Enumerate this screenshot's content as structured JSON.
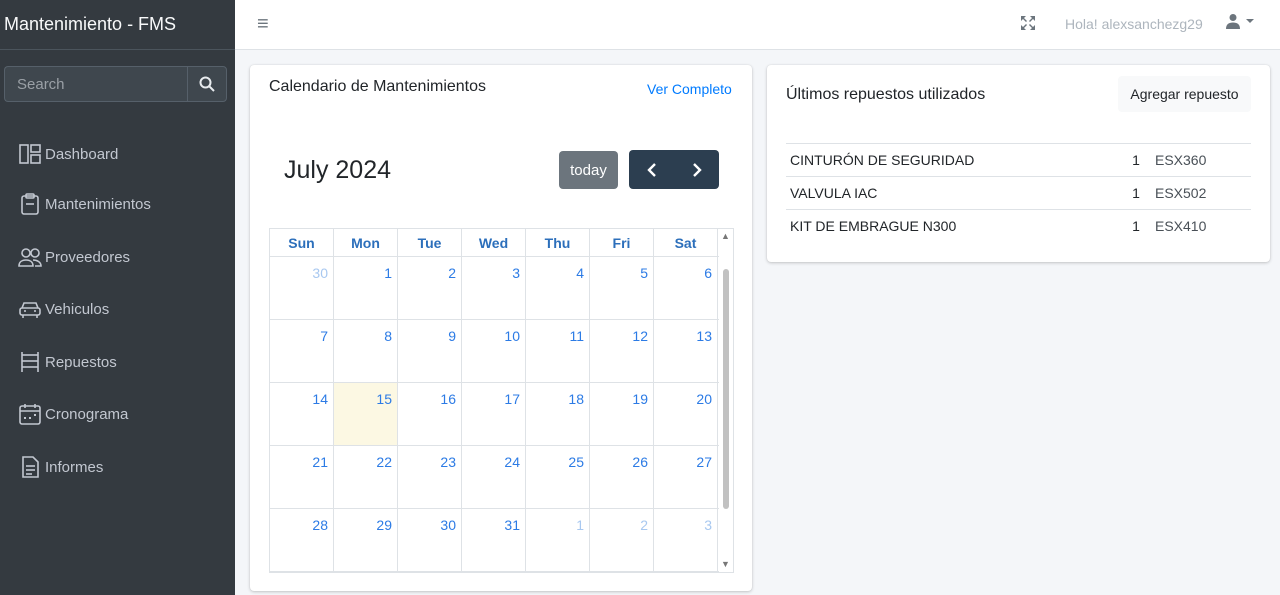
{
  "sidebar": {
    "brand": "Mantenimiento - FMS",
    "search_placeholder": "Search",
    "items": [
      {
        "label": "Dashboard",
        "icon": "dashboard-icon"
      },
      {
        "label": "Mantenimientos",
        "icon": "clipboard-icon"
      },
      {
        "label": "Proveedores",
        "icon": "people-icon"
      },
      {
        "label": "Vehiculos",
        "icon": "car-icon"
      },
      {
        "label": "Repuestos",
        "icon": "shelves-icon"
      },
      {
        "label": "Cronograma",
        "icon": "calendar-icon"
      },
      {
        "label": "Informes",
        "icon": "document-icon"
      }
    ]
  },
  "topbar": {
    "menu_icon": "≡",
    "greeting": "Hola! alexsanchezg29"
  },
  "calendar_card": {
    "title": "Calendario de Mantenimientos",
    "link": "Ver Completo",
    "month": "July 2024",
    "today_label": "today",
    "prev_label": "‹",
    "next_label": "›",
    "weekdays": [
      "Sun",
      "Mon",
      "Tue",
      "Wed",
      "Thu",
      "Fri",
      "Sat"
    ],
    "weeks": [
      [
        "30",
        "1",
        "2",
        "3",
        "4",
        "5",
        "6"
      ],
      [
        "7",
        "8",
        "9",
        "10",
        "11",
        "12",
        "13"
      ],
      [
        "14",
        "15",
        "16",
        "17",
        "18",
        "19",
        "20"
      ],
      [
        "21",
        "22",
        "23",
        "24",
        "25",
        "26",
        "27"
      ],
      [
        "28",
        "29",
        "30",
        "31",
        "1",
        "2",
        "3"
      ]
    ],
    "today_day": "15"
  },
  "parts_card": {
    "title": "Últimos repuestos utilizados",
    "add_label": "Agregar repuesto",
    "rows": [
      {
        "name": "CINTURÓN DE SEGURIDAD",
        "qty": "1",
        "code": "ESX360"
      },
      {
        "name": "VALVULA IAC",
        "qty": "1",
        "code": "ESX502"
      },
      {
        "name": "KIT DE EMBRAGUE N300",
        "qty": "1",
        "code": "ESX410"
      }
    ]
  }
}
